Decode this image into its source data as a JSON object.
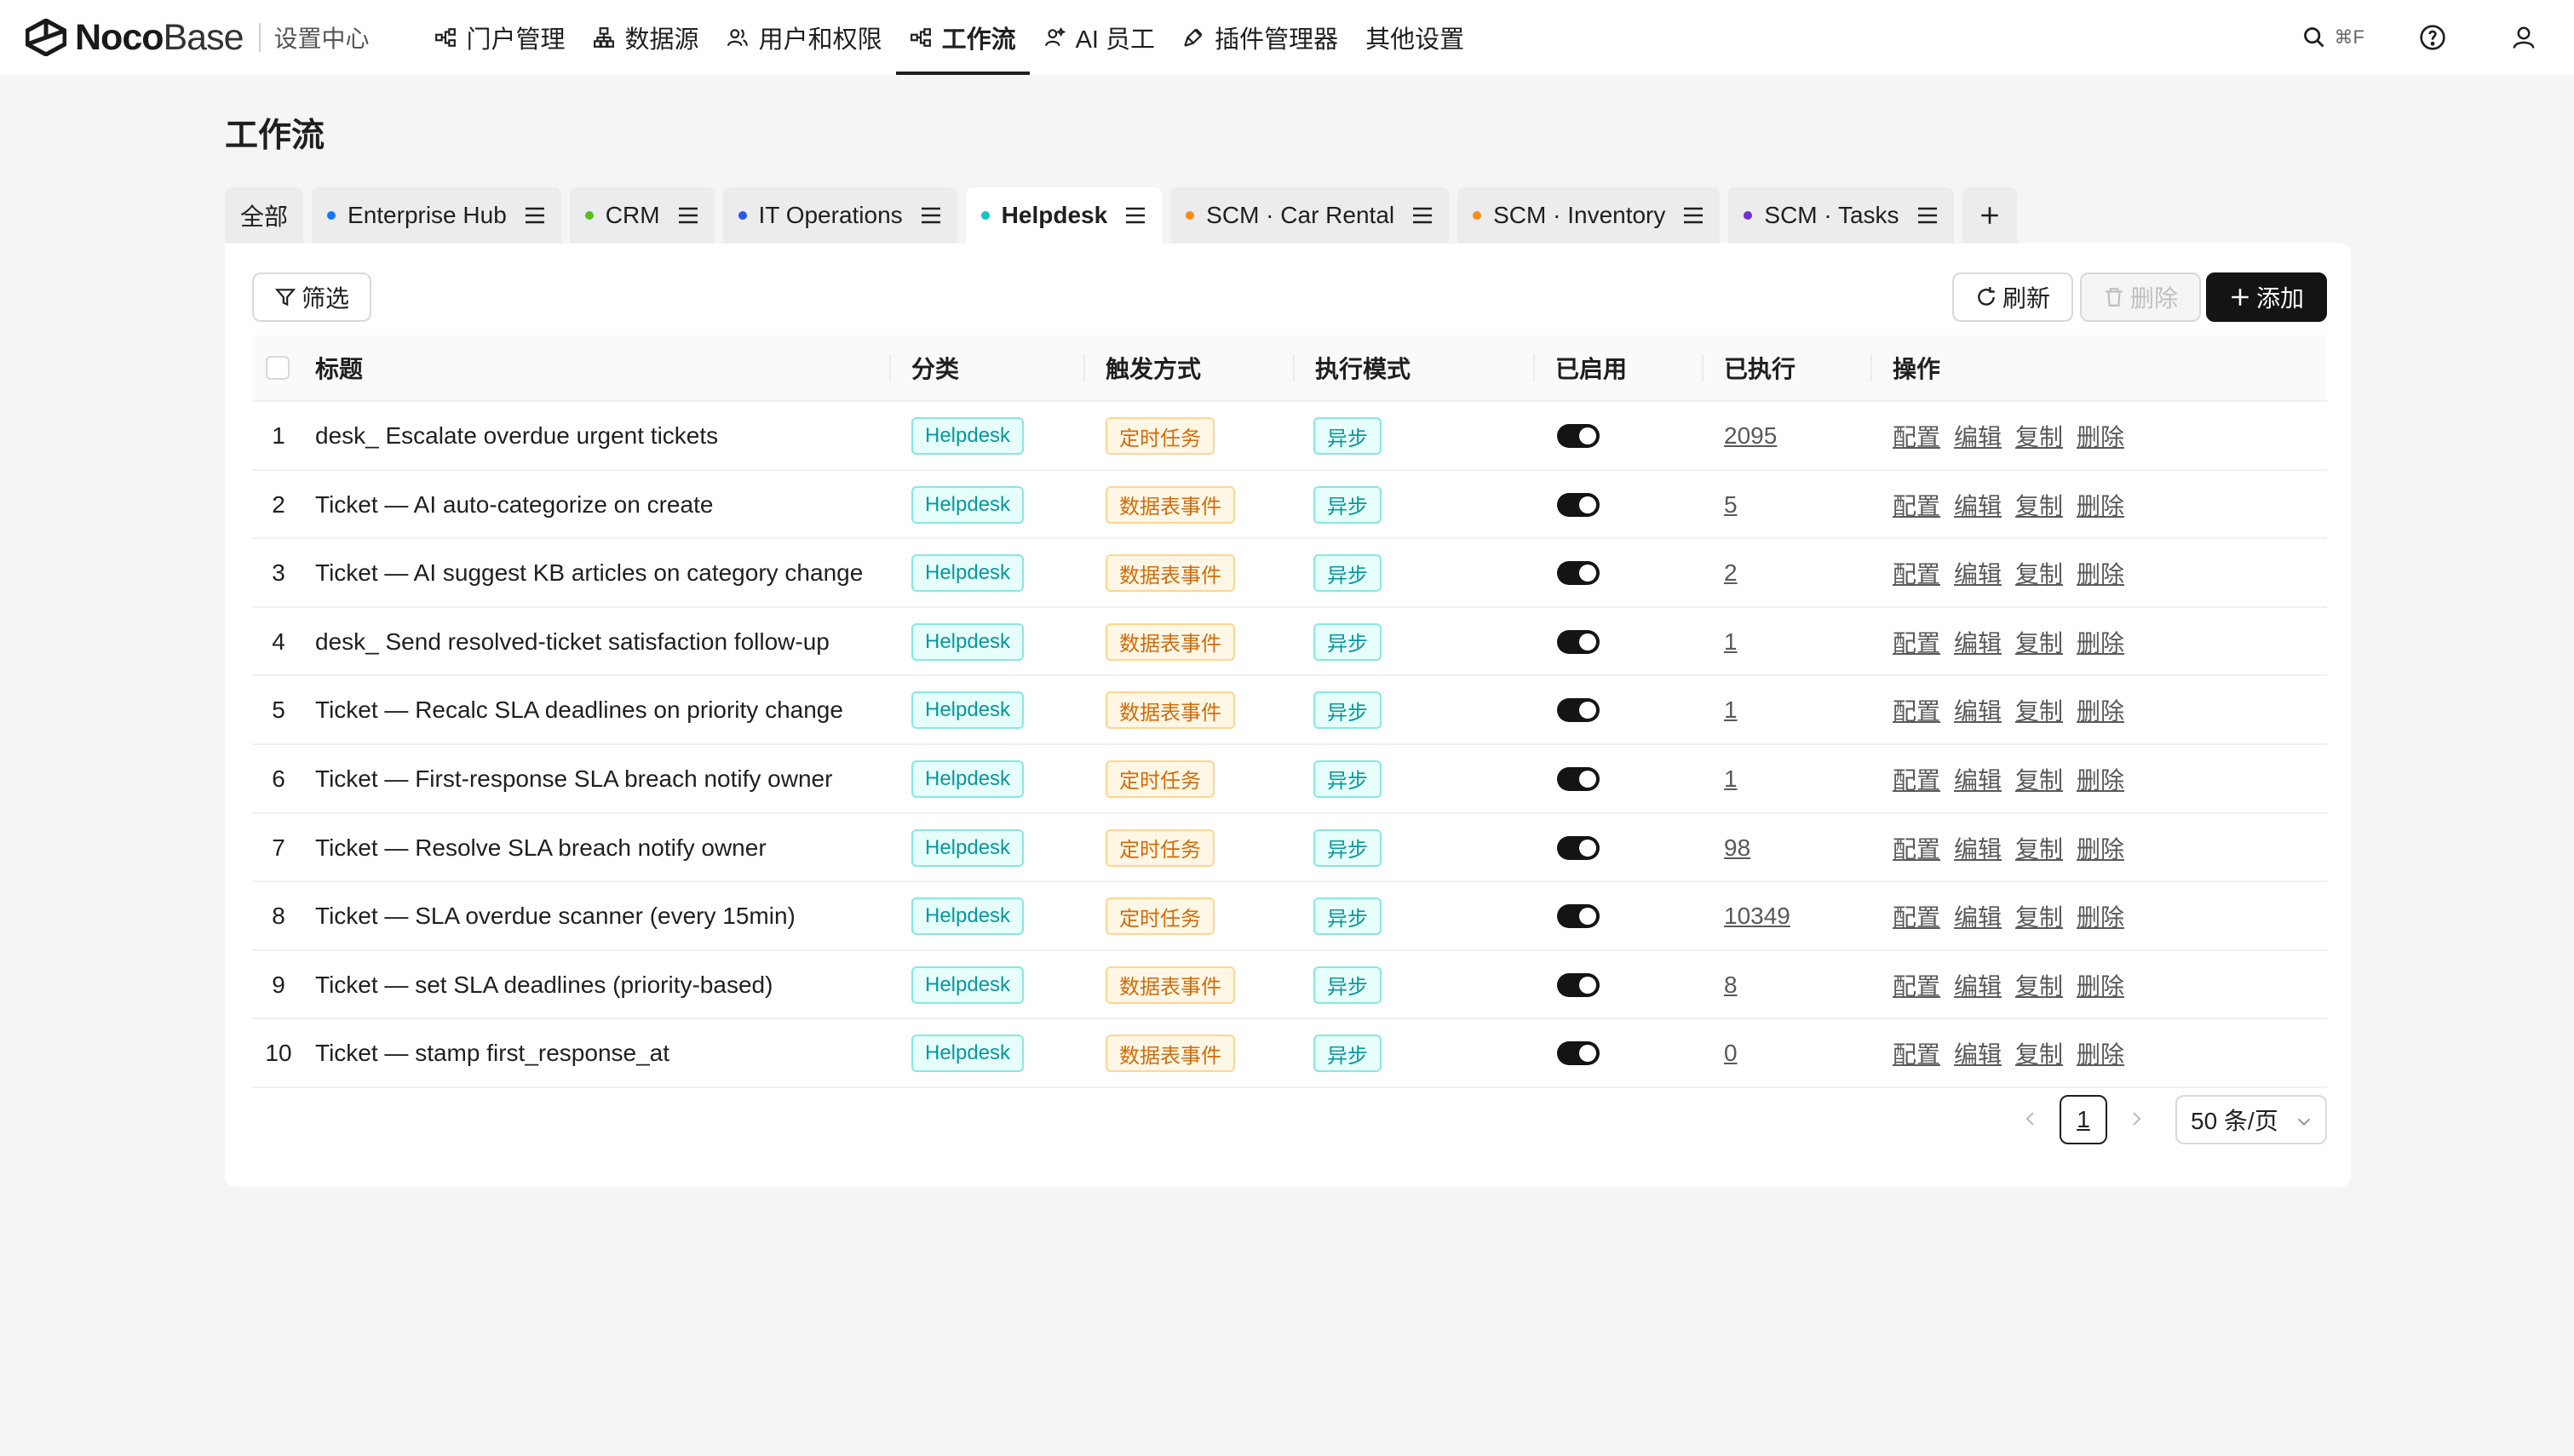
{
  "brand": {
    "noco": "Noco",
    "base": "Base",
    "subtitle": "设置中心"
  },
  "topnav": [
    {
      "label": "门户管理",
      "icon": "workflow-icon"
    },
    {
      "label": "数据源",
      "icon": "database-icon"
    },
    {
      "label": "用户和权限",
      "icon": "users-icon"
    },
    {
      "label": "工作流",
      "icon": "workflow-icon",
      "active": true
    },
    {
      "label": "AI 员工",
      "icon": "ai-user-icon"
    },
    {
      "label": "插件管理器",
      "icon": "plugin-icon"
    },
    {
      "label": "其他设置",
      "icon": ""
    }
  ],
  "header_right": {
    "search_shortcut": "⌘F"
  },
  "page": {
    "title": "工作流"
  },
  "tabs": [
    {
      "label": "全部",
      "dot": ""
    },
    {
      "label": "Enterprise Hub",
      "dot": "#1677ff"
    },
    {
      "label": "CRM",
      "dot": "#52c41a"
    },
    {
      "label": "IT Operations",
      "dot": "#2f54eb"
    },
    {
      "label": "Helpdesk",
      "dot": "#13c2c2",
      "active": true
    },
    {
      "label": "SCM · Car Rental",
      "dot": "#fa8c16"
    },
    {
      "label": "SCM · Inventory",
      "dot": "#fa8c16"
    },
    {
      "label": "SCM · Tasks",
      "dot": "#722ed1"
    }
  ],
  "toolbar": {
    "filter": "筛选",
    "refresh": "刷新",
    "delete": "删除",
    "add": "添加"
  },
  "table": {
    "headers": {
      "title": "标题",
      "category": "分类",
      "trigger": "触发方式",
      "mode": "执行模式",
      "enabled": "已启用",
      "executed": "已执行",
      "actions": "操作"
    },
    "action_labels": [
      "配置",
      "编辑",
      "复制",
      "删除"
    ],
    "rows": [
      {
        "index": "1",
        "title": "desk_ Escalate overdue urgent tickets",
        "category": "Helpdesk",
        "trigger": "定时任务",
        "mode": "异步",
        "enabled": true,
        "executed": "2095"
      },
      {
        "index": "2",
        "title": "Ticket — AI auto-categorize on create",
        "category": "Helpdesk",
        "trigger": "数据表事件",
        "mode": "异步",
        "enabled": true,
        "executed": "5"
      },
      {
        "index": "3",
        "title": "Ticket — AI suggest KB articles on category change",
        "category": "Helpdesk",
        "trigger": "数据表事件",
        "mode": "异步",
        "enabled": true,
        "executed": "2"
      },
      {
        "index": "4",
        "title": "desk_ Send resolved-ticket satisfaction follow-up",
        "category": "Helpdesk",
        "trigger": "数据表事件",
        "mode": "异步",
        "enabled": true,
        "executed": "1"
      },
      {
        "index": "5",
        "title": "Ticket — Recalc SLA deadlines on priority change",
        "category": "Helpdesk",
        "trigger": "数据表事件",
        "mode": "异步",
        "enabled": true,
        "executed": "1"
      },
      {
        "index": "6",
        "title": "Ticket — First-response SLA breach notify owner",
        "category": "Helpdesk",
        "trigger": "定时任务",
        "mode": "异步",
        "enabled": true,
        "executed": "1"
      },
      {
        "index": "7",
        "title": "Ticket — Resolve SLA breach notify owner",
        "category": "Helpdesk",
        "trigger": "定时任务",
        "mode": "异步",
        "enabled": true,
        "executed": "98"
      },
      {
        "index": "8",
        "title": "Ticket — SLA overdue scanner (every 15min)",
        "category": "Helpdesk",
        "trigger": "定时任务",
        "mode": "异步",
        "enabled": true,
        "executed": "10349"
      },
      {
        "index": "9",
        "title": "Ticket — set SLA deadlines (priority-based)",
        "category": "Helpdesk",
        "trigger": "数据表事件",
        "mode": "异步",
        "enabled": true,
        "executed": "8"
      },
      {
        "index": "10",
        "title": "Ticket — stamp first_response_at",
        "category": "Helpdesk",
        "trigger": "数据表事件",
        "mode": "异步",
        "enabled": true,
        "executed": "0"
      }
    ]
  },
  "pagination": {
    "current_page": "1",
    "page_size": "50 条/页"
  }
}
